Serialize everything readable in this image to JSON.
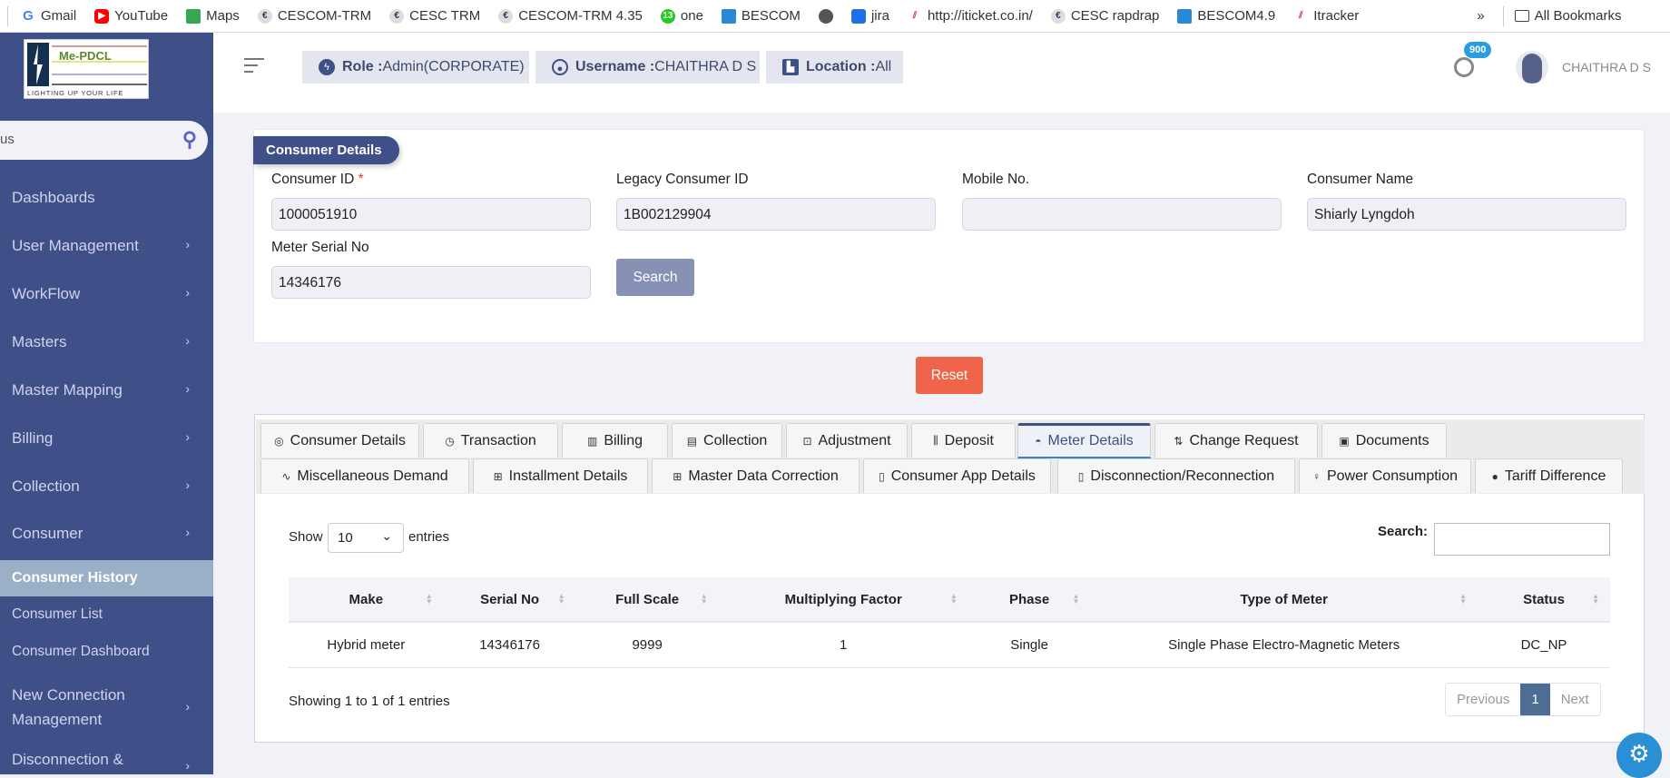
{
  "bookmarks": [
    "Gmail",
    "YouTube",
    "Maps",
    "CESCOM-TRM",
    "CESC TRM",
    "CESCOM-TRM 4.35",
    "one",
    "BESCOM",
    "jira",
    "http://iticket.co.in/",
    "CESC rapdrap",
    "BESCOM4.9",
    "Itracker"
  ],
  "bookmarks_more": "»",
  "bookmarks_all": "All Bookmarks",
  "logo": {
    "name": "Me-PDCL",
    "tagline": "LIGHTING UP YOUR LIFE"
  },
  "sidebar": {
    "search_value": "us",
    "items": [
      {
        "label": "Dashboards"
      },
      {
        "label": "User Management"
      },
      {
        "label": "WorkFlow"
      },
      {
        "label": "Masters"
      },
      {
        "label": "Master Mapping"
      },
      {
        "label": "Billing"
      },
      {
        "label": "Collection"
      },
      {
        "label": "Consumer"
      },
      {
        "label": "Consumer History"
      },
      {
        "label": "Consumer List"
      },
      {
        "label": "Consumer Dashboard"
      },
      {
        "label": "New Connection Management"
      },
      {
        "label": "Disconnection &"
      }
    ],
    "chevron": "›"
  },
  "header": {
    "role_label": "Role :",
    "role_value": "Admin(CORPORATE)",
    "username_label": "Username :",
    "username_value": "CHAITHRA D S",
    "location_label": "Location :",
    "location_value": "All",
    "notif_count": "900",
    "user_name": "CHAITHRA D S"
  },
  "form": {
    "section_title": "Consumer Details",
    "consumer_id_label": "Consumer ID",
    "required_mark": "*",
    "consumer_id": "1000051910",
    "legacy_label": "Legacy Consumer ID",
    "legacy_id": "1B002129904",
    "mobile_label": "Mobile No.",
    "mobile": "",
    "name_label": "Consumer Name",
    "name": "Shiarly Lyngdoh",
    "meter_label": "Meter Serial No",
    "meter_serial": "14346176",
    "search_btn": "Search",
    "reset_btn": "Reset"
  },
  "tabs": [
    {
      "label": "Consumer Details",
      "icon": "◎"
    },
    {
      "label": "Transaction",
      "icon": "◷"
    },
    {
      "label": "Billing",
      "icon": "▥"
    },
    {
      "label": "Collection",
      "icon": "▤"
    },
    {
      "label": "Adjustment",
      "icon": "⊡"
    },
    {
      "label": "Deposit",
      "icon": "⫼"
    },
    {
      "label": "Meter Details",
      "icon": "◓"
    },
    {
      "label": "Change Request",
      "icon": "⇅"
    },
    {
      "label": "Documents",
      "icon": "▣"
    },
    {
      "label": "Miscellaneous Demand",
      "icon": "∿"
    },
    {
      "label": "Installment Details",
      "icon": "⊞"
    },
    {
      "label": "Master Data Correction",
      "icon": "⊞"
    },
    {
      "label": "Consumer App Details",
      "icon": "▯"
    },
    {
      "label": "Disconnection/Reconnection",
      "icon": "▯"
    },
    {
      "label": "Power Consumption",
      "icon": "♀"
    },
    {
      "label": "Tariff Difference",
      "icon": "●"
    }
  ],
  "table": {
    "show": "Show",
    "length": "10",
    "entries": "entries",
    "search_label": "Search:",
    "search_value": "",
    "columns": [
      "Make",
      "Serial No",
      "Full Scale",
      "Multiplying Factor",
      "Phase",
      "Type of Meter",
      "Status"
    ],
    "rows": [
      [
        "Hybrid meter",
        "14346176",
        "9999",
        "1",
        "Single",
        "Single Phase Electro-Magnetic Meters",
        "DC_NP"
      ]
    ],
    "info": "Showing 1 to 1 of 1 entries",
    "prev": "Previous",
    "page": "1",
    "next": "Next"
  },
  "colors": {
    "sidebar": "#3f4f87",
    "active_item": "#9ab0c6",
    "reset": "#f0654a",
    "search_btn": "#8791b5"
  }
}
